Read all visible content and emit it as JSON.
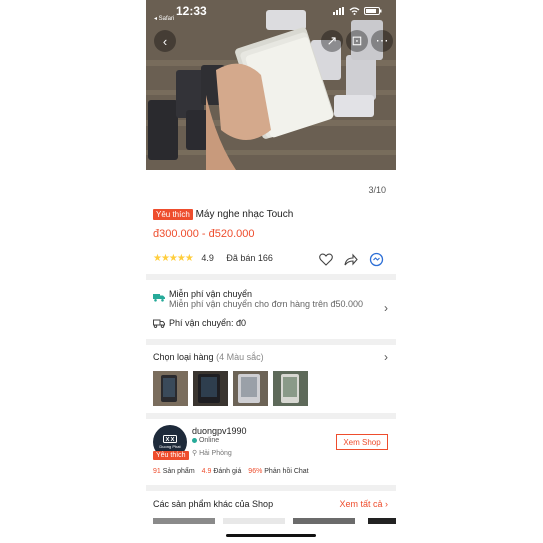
{
  "status": {
    "time": "12:33",
    "back_app": "◂ Safari"
  },
  "image_counter": "3/10",
  "product": {
    "badge": "Yêu thích",
    "title": "Máy nghe nhạc Touch",
    "price": "đ300.000 - đ520.000",
    "rating": "4.9",
    "sold": "Đã bán 166"
  },
  "shipping": {
    "free_title": "Miễn phí vận chuyển",
    "free_sub": "Miễn phí vận chuyển cho đơn hàng trên đ50.000",
    "fee_label": "Phí vận chuyển: đ0"
  },
  "variants": {
    "title": "Chọn loại hàng",
    "count": "(4 Màu sắc)"
  },
  "shop": {
    "avatar_text": "Duong Phat",
    "badge": "Yêu thích",
    "name": "duongpv1990",
    "status": "Online",
    "location": "Hải Phòng",
    "view_button": "Xem Shop",
    "products_count": "91",
    "products_label": "Sản phẩm",
    "rating": "4.9",
    "rating_label": "Đánh giá",
    "chat_rate": "96%",
    "chat_label": "Phản hồi Chat"
  },
  "other": {
    "title": "Các sản phẩm khác của Shop",
    "see_all": "Xem tất cả"
  },
  "colors": {
    "accent": "#ee4d2d",
    "star": "#ffce3d",
    "divider": "#f0f0f0"
  }
}
